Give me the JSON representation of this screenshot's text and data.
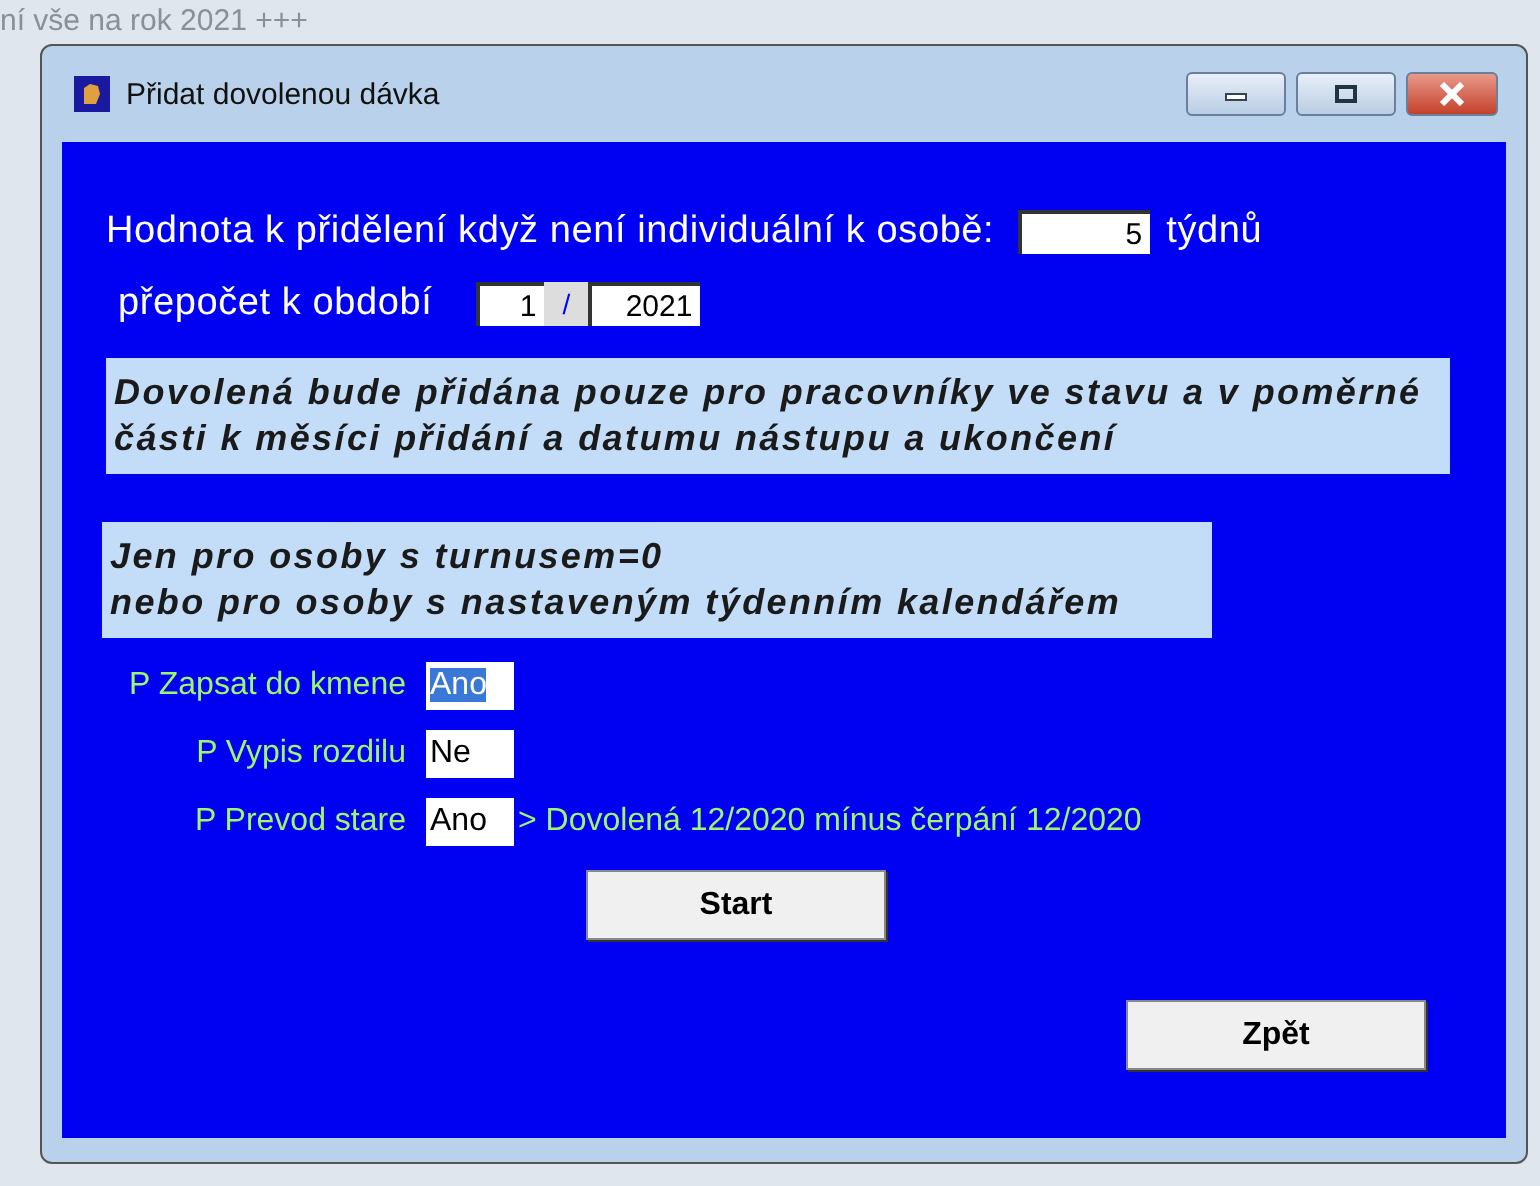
{
  "background_text": "ní vše na rok 2021 +++",
  "window": {
    "title": "Přidat dovolenou dávka"
  },
  "weeks": {
    "label": "Hodnota k přidělení když není individuální k osobě:",
    "value": "5",
    "unit": "týdnů"
  },
  "period": {
    "label": "přepočet k období",
    "month": "1",
    "separator": "/",
    "year": "2021"
  },
  "notes": [
    "Dovolená bude přidána pouze pro pracovníky ve stavu a v poměrné\nčásti k měsíci přidání a datumu nástupu a ukončení",
    "Jen pro osoby s turnusem=0\nnebo pro osoby s nastaveným týdenním kalendářem"
  ],
  "options": [
    {
      "label": "P Zapsat do kmene",
      "value": "Ano",
      "selected": true
    },
    {
      "label": "P Vypis rozdilu",
      "value": "Ne",
      "selected": false
    },
    {
      "label": "P Prevod stare",
      "value": "Ano",
      "selected": false,
      "hint": "> Dovolená 12/2020 mínus čerpání 12/2020"
    }
  ],
  "buttons": {
    "start": "Start",
    "back": "Zpět"
  }
}
